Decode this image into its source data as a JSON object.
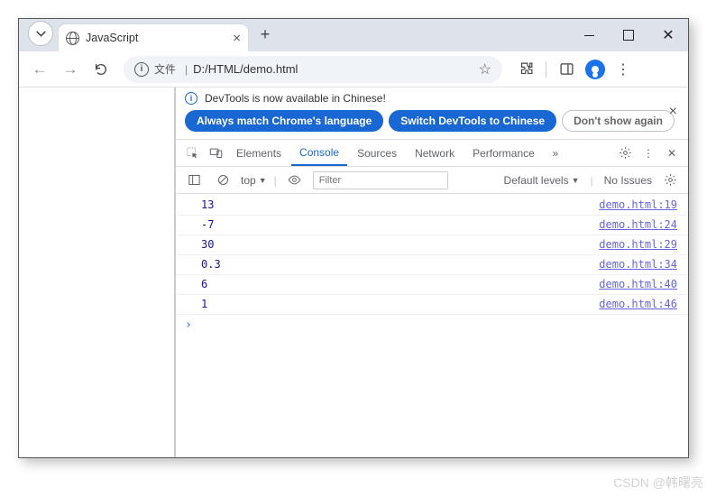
{
  "window": {
    "tab_title": "JavaScript"
  },
  "toolbar": {
    "file_label": "文件",
    "url": "D:/HTML/demo.html"
  },
  "devtools": {
    "infobar": {
      "text": "DevTools is now available in Chinese!"
    },
    "lang_buttons": {
      "match": "Always match Chrome's language",
      "switch": "Switch DevTools to Chinese",
      "dismiss": "Don't show again"
    },
    "tabs": {
      "elements": "Elements",
      "console": "Console",
      "sources": "Sources",
      "network": "Network",
      "performance": "Performance"
    },
    "console_toolbar": {
      "context": "top",
      "filter_placeholder": "Filter",
      "levels": "Default levels",
      "issues": "No Issues"
    },
    "logs": [
      {
        "value": "13",
        "source": "demo.html:19"
      },
      {
        "value": "-7",
        "source": "demo.html:24"
      },
      {
        "value": "30",
        "source": "demo.html:29"
      },
      {
        "value": "0.3",
        "source": "demo.html:34"
      },
      {
        "value": "6",
        "source": "demo.html:40"
      },
      {
        "value": "1",
        "source": "demo.html:46"
      }
    ]
  },
  "watermark": "CSDN @韩曙亮"
}
